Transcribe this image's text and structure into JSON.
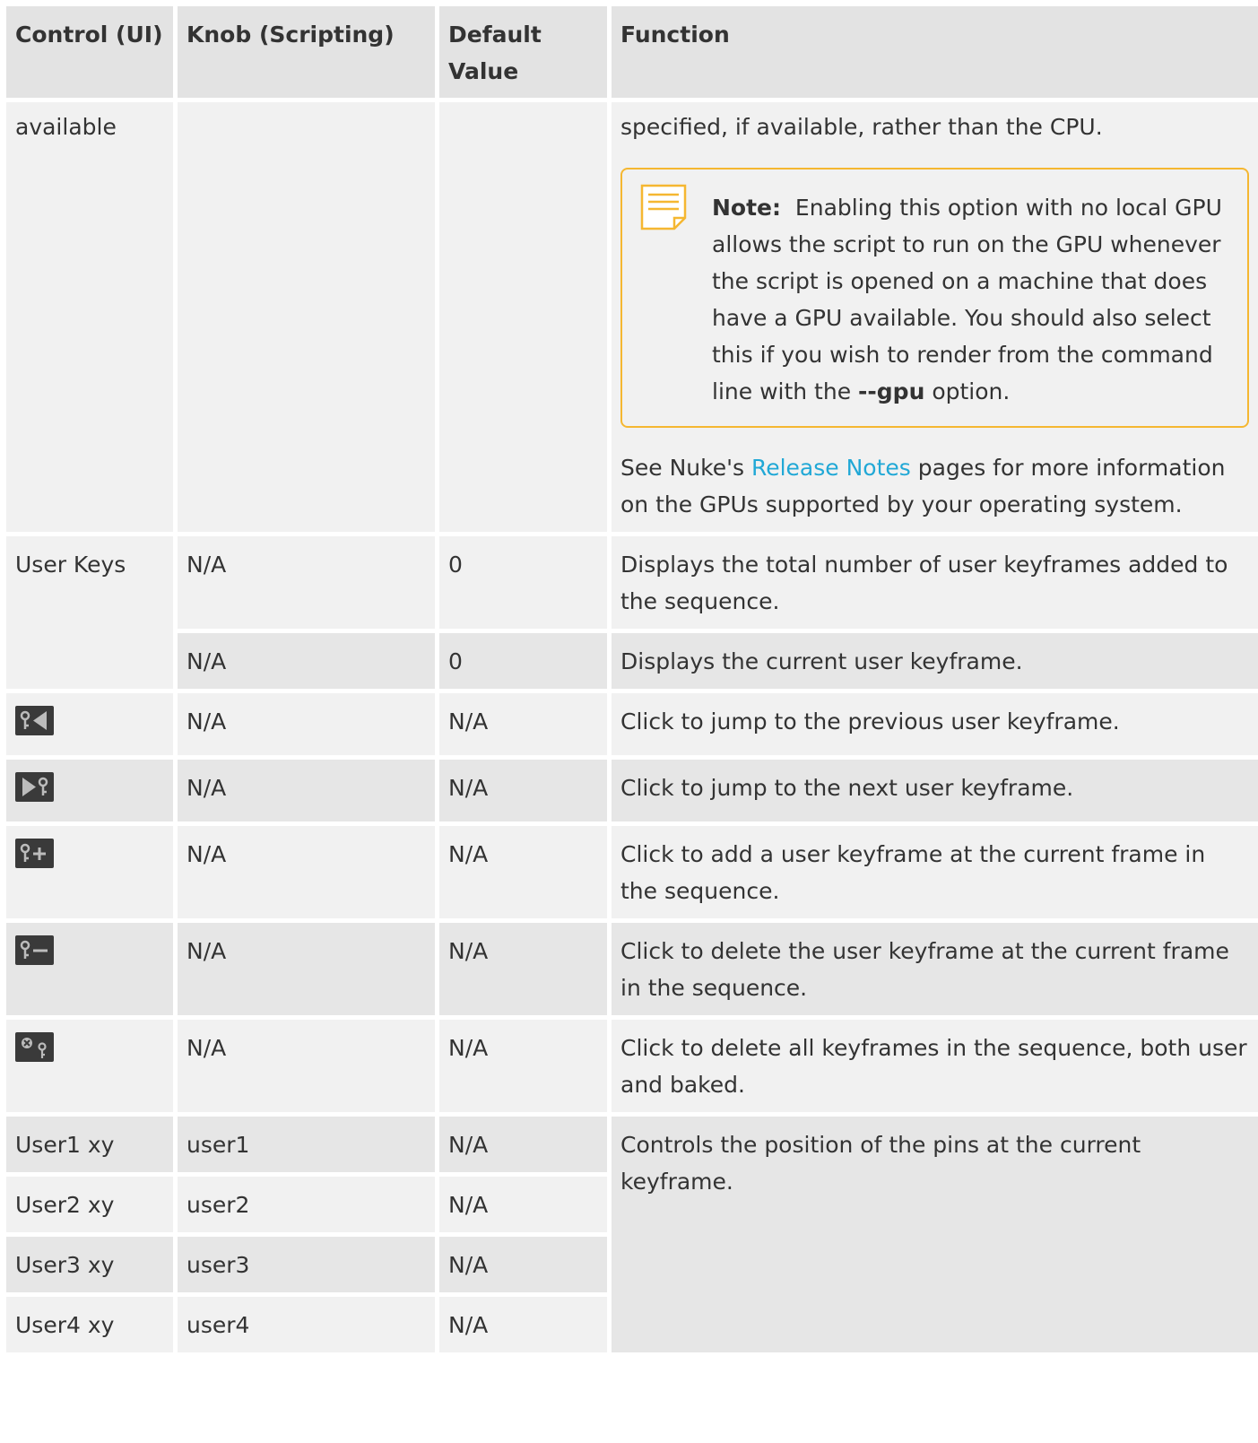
{
  "table": {
    "headers": [
      "Control (UI)",
      "Knob (Scripting)",
      "Default Value",
      "Function"
    ],
    "row_gpu": {
      "control": "available",
      "knob": "",
      "default": "",
      "func_intro": "specified, if available, rather than the CPU.",
      "note_label": "Note:",
      "note_text": "Enabling this option with no local GPU allows the script to run on the GPU whenever the script is opened on a machine that does have a GPU available. You should also select this if you wish to render from the command line with the",
      "note_flag": "--gpu",
      "note_tail": "option.",
      "see_prefix": "See Nuke's",
      "see_link": "Release Notes",
      "see_suffix": "pages for more information on the GPUs supported by your operating system."
    },
    "row_user_keys": {
      "control": "User Keys",
      "knob": "N/A",
      "default": "0",
      "func": "Displays the total number of user keyframes added to the sequence."
    },
    "row_current_key": {
      "control": "",
      "knob": "N/A",
      "default": "0",
      "func": "Displays the current user keyframe."
    },
    "icon_rows": [
      {
        "icon": "previous-keyframe-icon",
        "knob": "N/A",
        "default": "N/A",
        "func": "Click to jump to the previous user keyframe."
      },
      {
        "icon": "next-keyframe-icon",
        "knob": "N/A",
        "default": "N/A",
        "func": "Click to jump to the next user keyframe."
      },
      {
        "icon": "add-keyframe-icon",
        "knob": "N/A",
        "default": "N/A",
        "func": "Click to add a user keyframe at the current frame in the sequence."
      },
      {
        "icon": "delete-keyframe-icon",
        "knob": "N/A",
        "default": "N/A",
        "func": "Click to delete the user keyframe at the current frame in the sequence."
      },
      {
        "icon": "delete-all-keyframes-icon",
        "knob": "N/A",
        "default": "N/A",
        "func": "Click to delete all keyframes in the sequence, both user and baked."
      }
    ],
    "user_rows": [
      {
        "control": "User1 xy",
        "knob": "user1",
        "default": "N/A"
      },
      {
        "control": "User2 xy",
        "knob": "user2",
        "default": "N/A"
      },
      {
        "control": "User3 xy",
        "knob": "user3",
        "default": "N/A"
      },
      {
        "control": "User4 xy",
        "knob": "user4",
        "default": "N/A"
      }
    ],
    "user_rows_func": "Controls the position of the pins at the current keyframe."
  },
  "colors": {
    "header_bg": "#e3e3e3",
    "cell_bg": "#f1f1f1",
    "cell_alt_bg": "#e6e6e6",
    "note_border": "#f5b731",
    "link": "#21a8d6"
  }
}
